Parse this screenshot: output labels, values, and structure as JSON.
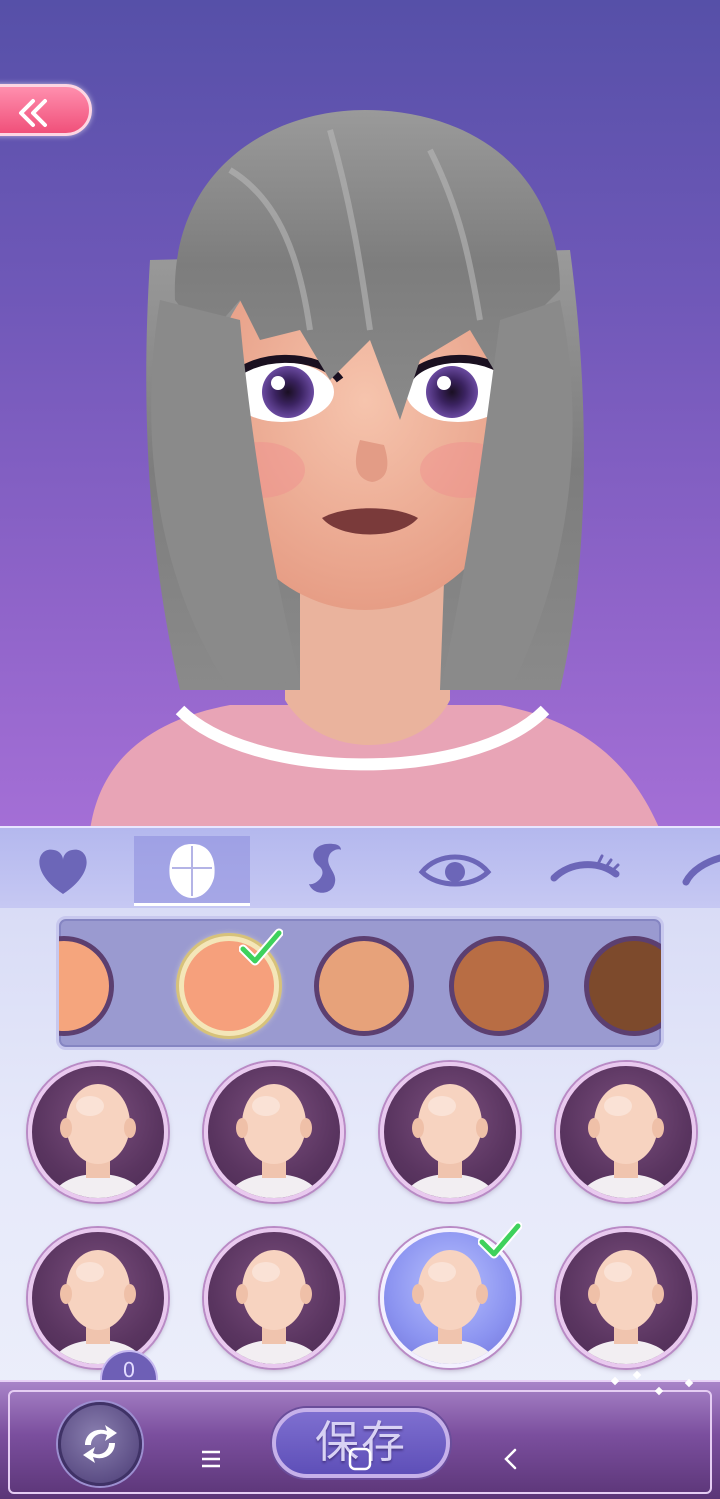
{
  "header": {
    "back_button": {
      "icon": "double-chevron-left-icon"
    }
  },
  "tabs": [
    {
      "icon": "heart-icon",
      "active": false
    },
    {
      "icon": "face-shape-icon",
      "active": true
    },
    {
      "icon": "hair-icon",
      "active": false
    },
    {
      "icon": "eye-icon",
      "active": false
    },
    {
      "icon": "eyebrow-icon",
      "active": false
    },
    {
      "icon": "eyeliner-icon",
      "active": false
    }
  ],
  "skin_tones": [
    {
      "color": "#f5a57d",
      "selected": false
    },
    {
      "color": "#f6a07c",
      "selected": true
    },
    {
      "color": "#e7a27a",
      "selected": false
    },
    {
      "color": "#b86d44",
      "selected": false
    },
    {
      "color": "#7d4a2c",
      "selected": false
    }
  ],
  "face_shapes": [
    {
      "selected": false
    },
    {
      "selected": false
    },
    {
      "selected": false
    },
    {
      "selected": false
    },
    {
      "selected": false
    },
    {
      "selected": false
    },
    {
      "selected": true
    },
    {
      "selected": false
    }
  ],
  "footer": {
    "count_badge": "0",
    "reset_icon": "swap-arrows-icon",
    "save_label": "保存",
    "nav": [
      "menu-icon",
      "home-icon",
      "back-icon"
    ]
  },
  "colors": {
    "accent": "#f0507a",
    "check": "#3ed15c",
    "panel": "#e6e9fa"
  }
}
